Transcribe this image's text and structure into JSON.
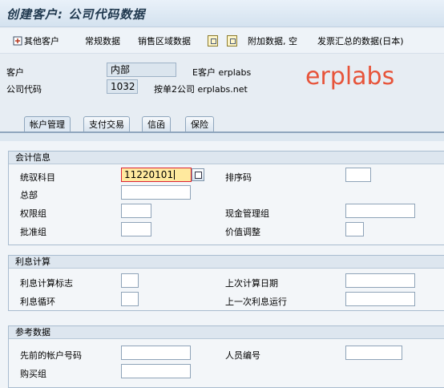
{
  "title": "创建客户: 公司代码数据",
  "toolbar": {
    "other_customer": "其他客户",
    "general_data": "常规数据",
    "sales_area_data": "销售区域数据",
    "additional_data": "附加数据, 空",
    "invoice_summary": "发票汇总的数据(日本)"
  },
  "header": {
    "customer_label": "客户",
    "customer_value": "内部",
    "customer_text": "E客户 erplabs",
    "company_label": "公司代码",
    "company_value": "1032",
    "company_text": "按单2公司 erplabs.net"
  },
  "watermark": "erplabs",
  "tabs": [
    "帐户管理",
    "支付交易",
    "信函",
    "保险"
  ],
  "groups": {
    "accounting": {
      "title": "会计信息",
      "recon_account_label": "统驭科目",
      "recon_account_value": "11220101",
      "sort_key_label": "排序码",
      "head_office_label": "总部",
      "auth_group_label": "权限组",
      "cash_mgmt_group_label": "现金管理组",
      "release_group_label": "批准组",
      "value_adjust_label": "价值调整"
    },
    "interest": {
      "title": "利息计算",
      "interest_indicator_label": "利息计算标志",
      "last_calc_date_label": "上次计算日期",
      "interest_cycle_label": "利息循环",
      "last_run_label": "上一次利息运行"
    },
    "reference": {
      "title": "参考数据",
      "prev_account_label": "先前的帐户号码",
      "personnel_no_label": "人员编号",
      "buying_group_label": "购买组"
    }
  }
}
